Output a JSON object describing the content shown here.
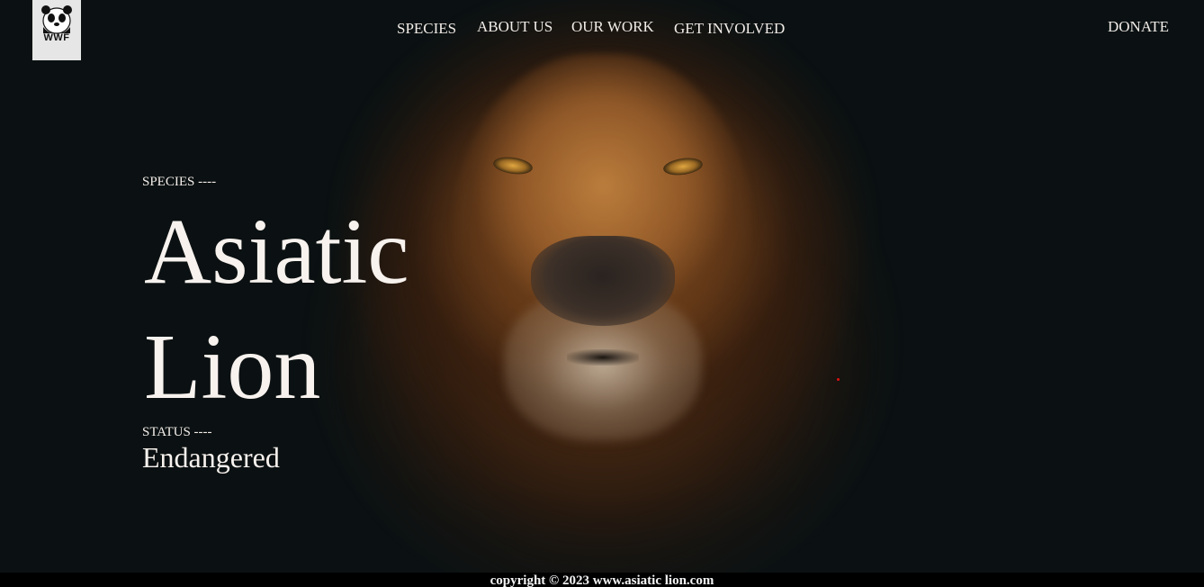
{
  "header": {
    "logo_text": "WWF",
    "nav": {
      "species": "SPECIES",
      "about": "ABOUT US",
      "work": "OUR WORK",
      "involved": "GET INVOLVED",
      "donate": "DONATE"
    }
  },
  "hero": {
    "kicker": "SPECIES ----",
    "title_line1": "Asiatic",
    "title_line2": "Lion",
    "status_label": "STATUS ----",
    "status_value": "Endangered",
    "image": "lion-face-photo"
  },
  "footer": {
    "copyright": "copyright © 2023 www.asiatic lion.com"
  },
  "colors": {
    "background": "#0b1112",
    "text": "#f4eeea",
    "logo_bg": "#e6e6e6",
    "footer_bg": "#000000"
  }
}
